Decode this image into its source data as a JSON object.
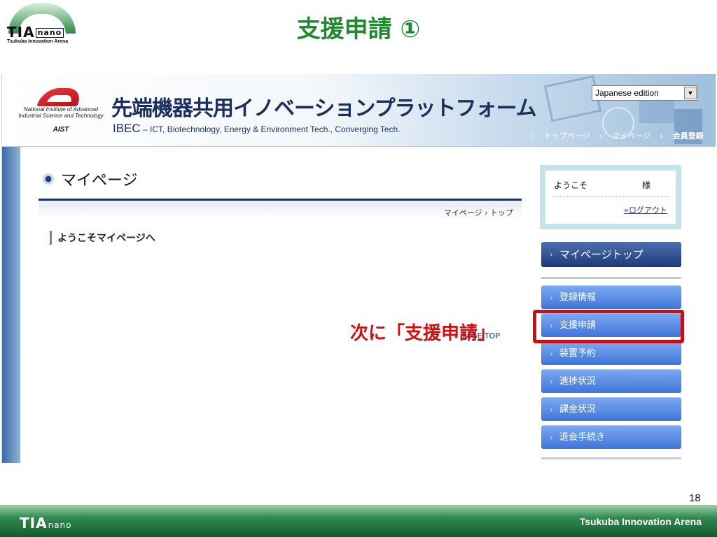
{
  "slide": {
    "title": "支援申請 ①",
    "logo_mark": "TIA",
    "logo_nano": "nano",
    "logo_sub": "Tsukuba Innovation Arena",
    "page_number": "18",
    "callout": "次に「支援申請」",
    "footer_logo_mark": "TIA",
    "footer_logo_nano": "nano",
    "footer_right": "Tsukuba Innovation Arena"
  },
  "site": {
    "aist_name": "National Institute of Advanced Industrial Science and Technology",
    "aist_abbr": "AIST",
    "title": "先端機器共用イノベーションプラットフォーム",
    "subtitle_prefix": "IBEC",
    "subtitle_rest": " – ICT, Biotechnology, Energy & Environment Tech., Converging Tech.",
    "language": "Japanese edition",
    "nav": [
      "トップページ",
      "マイページ",
      "会員登録"
    ]
  },
  "main": {
    "heading": "マイページ",
    "breadcrumb": "マイページ › トップ",
    "welcome_heading": "ようこそマイページへ",
    "page_top": "PAGE TOP"
  },
  "sidebar": {
    "hello": "ようこそ",
    "sama": "様",
    "logout": "ログアウト",
    "mypage_top": "マイページトップ",
    "menu": [
      "登録情報",
      "支援申請",
      "装置予約",
      "進捗状況",
      "課金状況",
      "退会手続き"
    ]
  },
  "colors": {
    "title_green": "#1f8a2e",
    "callout_red": "#d01010",
    "menu_blue": "#3f75d8",
    "navy": "#1a2f5c"
  }
}
